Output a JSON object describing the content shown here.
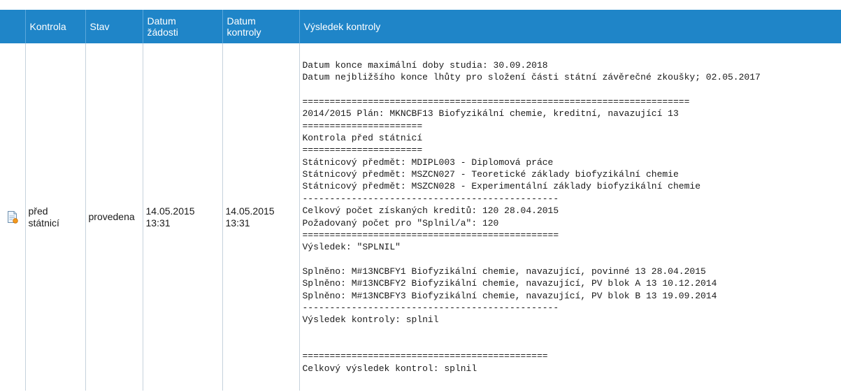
{
  "header": {
    "col_kontrola": "Kontrola",
    "col_stav": "Stav",
    "col_datum_zadosti": [
      "Datum",
      "žádosti"
    ],
    "col_datum_kontroly": [
      "Datum",
      "kontroly"
    ],
    "col_vysledek": "Výsledek kontroly"
  },
  "row": {
    "icon": "document-edit-icon",
    "kontrola": [
      "před",
      "státnicí"
    ],
    "stav": "provedena",
    "datum_zadosti": [
      "14.05.2015",
      "13:31"
    ],
    "datum_kontroly": [
      "14.05.2015",
      "13:31"
    ],
    "vysledek_lines": [
      "Datum konce maximální doby studia: 30.09.2018",
      "Datum nejbližšího konce lhůty pro složení části státní závěrečné zkoušky; 02.05.2017",
      "",
      "=======================================================================",
      "2014/2015 Plán: MKNCBF13 Biofyzikální chemie, kreditní, navazující 13",
      "======================",
      "Kontrola před státnicí",
      "======================",
      "Státnicový předmět: MDIPL003 - Diplomová práce",
      "Státnicový předmět: MSZCN027 - Teoretické základy biofyzikální chemie",
      "Státnicový předmět: MSZCN028 - Experimentální základy biofyzikální chemie",
      "-----------------------------------------------",
      "Celkový počet získaných kreditů: 120 28.04.2015",
      "Požadovaný počet pro \"Splnil/a\": 120",
      "===============================================",
      "Výsledek: \"SPLNIL\"",
      "",
      "Splněno: M#13NCBFY1 Biofyzikální chemie, navazující, povinné 13 28.04.2015",
      "Splněno: M#13NCBFY2 Biofyzikální chemie, navazující, PV blok A 13 10.12.2014",
      "Splněno: M#13NCBFY3 Biofyzikální chemie, navazující, PV blok B 13 19.09.2014",
      "-----------------------------------------------",
      "Výsledek kontroly: splnil",
      "",
      "",
      "=============================================",
      "Celkový výsledek kontrol: splnil"
    ]
  },
  "colors": {
    "header_bg": "#1f85c8",
    "header_text": "#ffffff",
    "grid_line": "#c6d2dc"
  }
}
